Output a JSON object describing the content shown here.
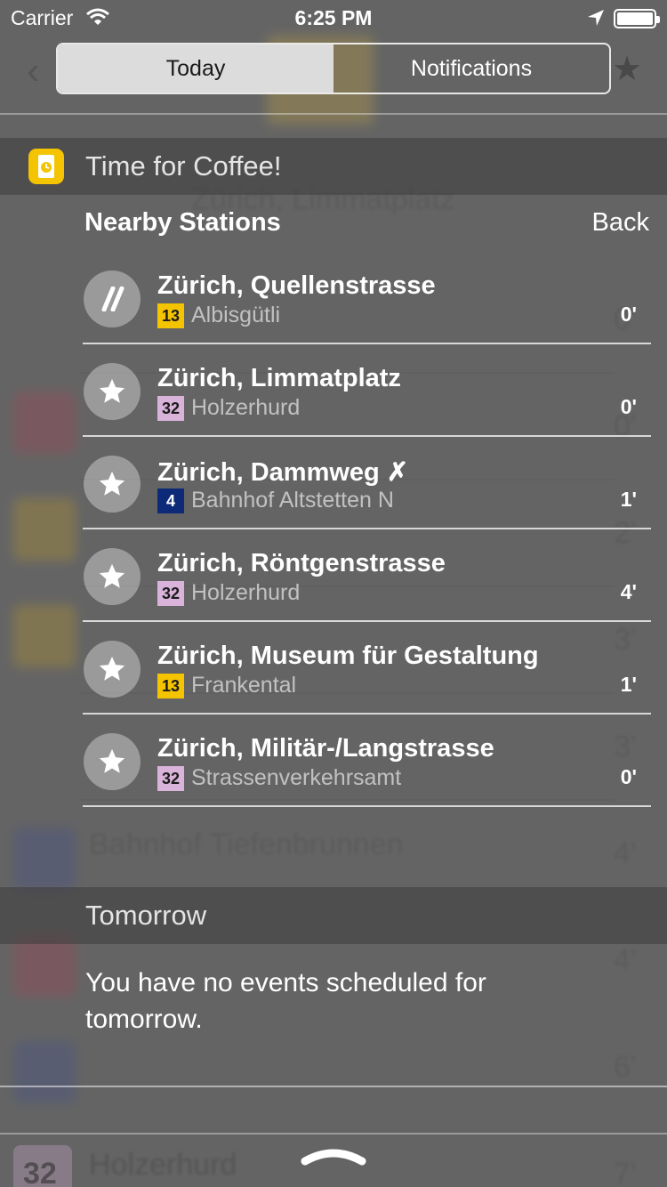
{
  "status_bar": {
    "carrier": "Carrier",
    "time": "6:25 PM"
  },
  "tabs": [
    {
      "label": "Today",
      "active": true
    },
    {
      "label": "Notifications",
      "active": false
    }
  ],
  "widget": {
    "title": "Time for Coffee!",
    "section_title": "Nearby Stations",
    "back_label": "Back",
    "stations": [
      {
        "name": "Zürich, Quellenstrasse",
        "line": "13",
        "line_color": "#f5c400",
        "line_text_color": "#1a1a1a",
        "direction": "Albisgütli",
        "minutes": "0'",
        "icon": "tram-stripe-icon"
      },
      {
        "name": "Zürich, Limmatplatz",
        "line": "32",
        "line_color": "#d9b3d9",
        "line_text_color": "#1a1a1a",
        "direction": "Holzerhurd",
        "minutes": "0'",
        "icon": "star-icon"
      },
      {
        "name": "Zürich, Dammweg ✗",
        "line": "4",
        "line_color": "#0d2a78",
        "line_text_color": "#ffffff",
        "direction": "Bahnhof Altstetten N",
        "minutes": "1'",
        "icon": "star-icon"
      },
      {
        "name": "Zürich, Röntgenstrasse",
        "line": "32",
        "line_color": "#d9b3d9",
        "line_text_color": "#1a1a1a",
        "direction": "Holzerhurd",
        "minutes": "4'",
        "icon": "star-icon"
      },
      {
        "name": "Zürich, Museum für Gestaltung",
        "line": "13",
        "line_color": "#f5c400",
        "line_text_color": "#1a1a1a",
        "direction": "Frankental",
        "minutes": "1'",
        "icon": "star-icon"
      },
      {
        "name": "Zürich, Militär-/Langstrasse",
        "line": "32",
        "line_color": "#d9b3d9",
        "line_text_color": "#1a1a1a",
        "direction": "Strassenverkehrsamt",
        "minutes": "0'",
        "icon": "star-icon"
      }
    ]
  },
  "tomorrow": {
    "title": "Tomorrow",
    "message": "You have no events scheduled for tomorrow."
  }
}
